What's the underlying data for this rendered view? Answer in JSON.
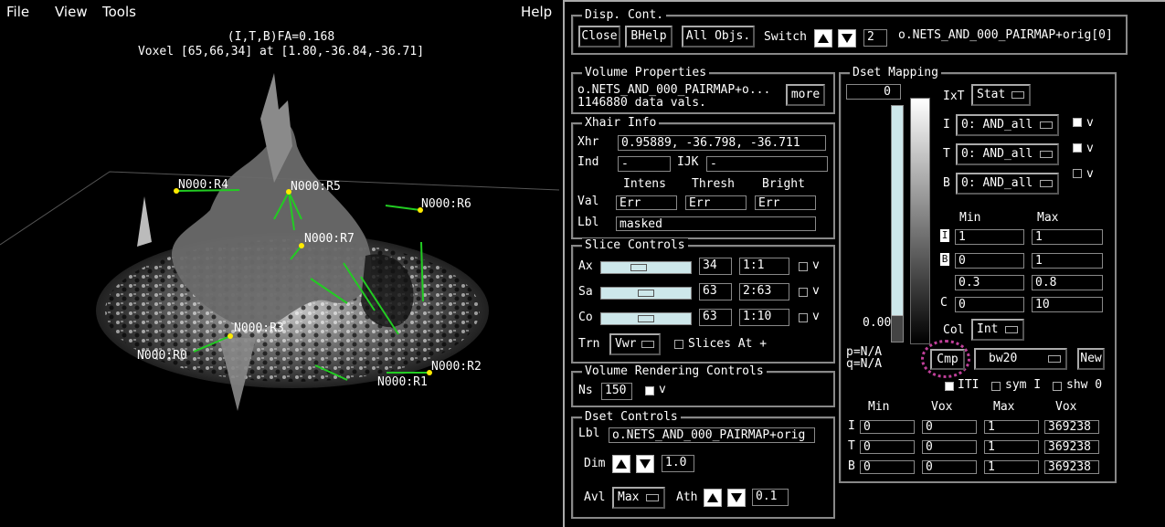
{
  "viewer": {
    "menu": [
      "File",
      "View",
      "Tools"
    ],
    "help": "Help",
    "header_line1": "(I,T,B)FA=0.168",
    "header_line2": "Voxel [65,66,34] at [1.80,-36.84,-36.71]",
    "node_labels": [
      "N000:R4",
      "N000:R5",
      "N000:R6",
      "N000:R7",
      "N000:R3",
      "N000:R0",
      "N000:R2",
      "N000:R1"
    ]
  },
  "disp_cont": {
    "title": "Disp. Cont.",
    "close": "Close",
    "bhelp": "BHelp",
    "all_objs": "All Objs.",
    "switch_label": "Switch",
    "switch_value": "2",
    "object_name": "o.NETS_AND_000_PAIRMAP+orig[0]"
  },
  "volume_properties": {
    "title": "Volume Properties",
    "line1": "o.NETS_AND_000_PAIRMAP+o...",
    "line2": "1146880 data vals.",
    "more": "more"
  },
  "xhair_info": {
    "title": "Xhair Info",
    "xhr_label": "Xhr",
    "xhr_value": "0.95889, -36.798, -36.711",
    "ind_label": "Ind",
    "ind_value": "-",
    "ijk_label": "IJK",
    "ijk_value": "-",
    "col_intens": "Intens",
    "col_thresh": "Thresh",
    "col_bright": "Bright",
    "val_label": "Val",
    "val_intens": "Err",
    "val_thresh": "Err",
    "val_bright": "Err",
    "lbl_label": "Lbl",
    "lbl_value": "masked"
  },
  "slice_controls": {
    "title": "Slice Controls",
    "ax_label": "Ax",
    "ax_value": "34",
    "ax_ratio": "1:1",
    "sa_label": "Sa",
    "sa_value": "63",
    "sa_ratio": "2:63",
    "co_label": "Co",
    "co_value": "63",
    "co_ratio": "1:10",
    "v": "v",
    "trn_label": "Trn",
    "trn_value": "Vwr",
    "slices_at": "Slices At +"
  },
  "volume_rendering": {
    "title": "Volume Rendering Controls",
    "ns_label": "Ns",
    "ns_value": "150",
    "v": "v"
  },
  "dset_controls": {
    "title": "Dset Controls",
    "lbl_label": "Lbl",
    "lbl_value": "o.NETS_AND_000_PAIRMAP+orig",
    "dim_label": "Dim",
    "dim_value": "1.0",
    "avl_label": "Avl",
    "avl_value": "Max",
    "ath_label": "Ath",
    "ath_value": "0.1"
  },
  "dset_mapping": {
    "title": "Dset Mapping",
    "top_value": "0",
    "bottom_value": "0.00",
    "pq1": "p=N/A",
    "pq2": "q=N/A",
    "ixt_label": "IxT",
    "ixt_value": "Stat",
    "i_label": "I",
    "i_value": "0: AND_all",
    "t_label": "T",
    "t_value": "0: AND_all",
    "b_label": "B",
    "b_value": "0: AND_all",
    "v": "v",
    "min_header": "Min",
    "max_header": "Max",
    "i_min": "1",
    "i_max": "1",
    "b_min": "0",
    "b_max": "1",
    "r3_min": "0.3",
    "r3_max": "0.8",
    "c_label": "C",
    "c_min": "0",
    "c_max": "10",
    "col_label": "Col",
    "col_value": "Int",
    "cmp_label": "Cmp",
    "cmp_value": "bw20",
    "new": "New",
    "iti": "ITI",
    "sym_i": "sym I",
    "shw_0": "shw 0",
    "range_headers": [
      "Min",
      "Vox",
      "Max",
      "Vox"
    ],
    "range_i_label": "I",
    "range_t_label": "T",
    "range_b_label": "B",
    "range_i": [
      "0",
      "0",
      "1",
      "369238"
    ],
    "range_t": [
      "0",
      "0",
      "1",
      "369238"
    ],
    "range_b": [
      "0",
      "0",
      "1",
      "369238"
    ]
  }
}
